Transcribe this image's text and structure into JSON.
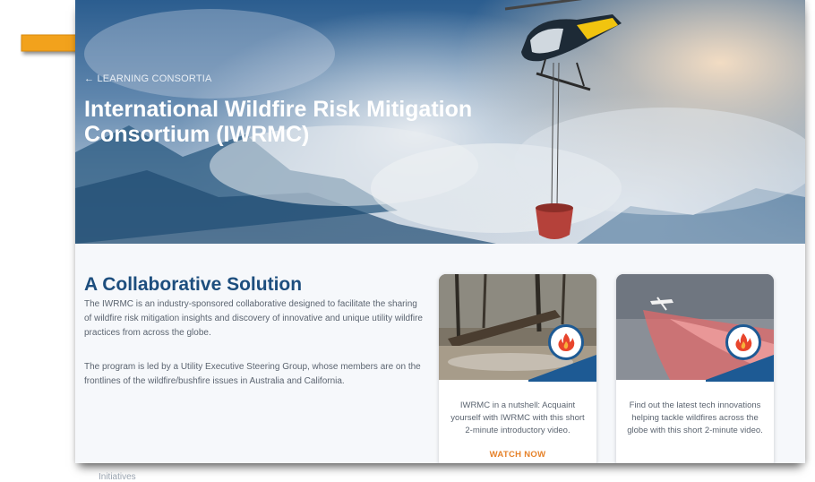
{
  "hero": {
    "breadcrumb": "← LEARNING CONSORTIA",
    "title": "International Wildfire Risk Mitigation Consortium (IWRMC)"
  },
  "main": {
    "heading": "A Collaborative Solution",
    "paragraphs": [
      "The IWRMC is an industry-sponsored collaborative designed to facilitate the sharing of wildfire risk mitigation insights and discovery of innovative and unique utility wildfire practices from across the globe.",
      "The program is led by a Utility Executive Steering Group, whose members are on the frontlines of the wildfire/bushfire issues in Australia and California."
    ]
  },
  "cards": [
    {
      "text": "IWRMC in a nutshell: Acquaint yourself with IWRMC with this short 2-minute introductory video.",
      "link": "WATCH NOW"
    },
    {
      "text": "Find out the latest tech innovations helping tackle wildfires across the globe with this short 2-minute video.",
      "link": ""
    }
  ],
  "below": "Initiatives",
  "colors": {
    "arrow": "#f2a21b",
    "heading": "#1d4e7e",
    "link": "#e6822a",
    "badge_ring": "#1d5a94",
    "flame": "#e8452c"
  },
  "icons": [
    "arrow-right-icon",
    "helicopter-illustration",
    "fire-icon"
  ]
}
